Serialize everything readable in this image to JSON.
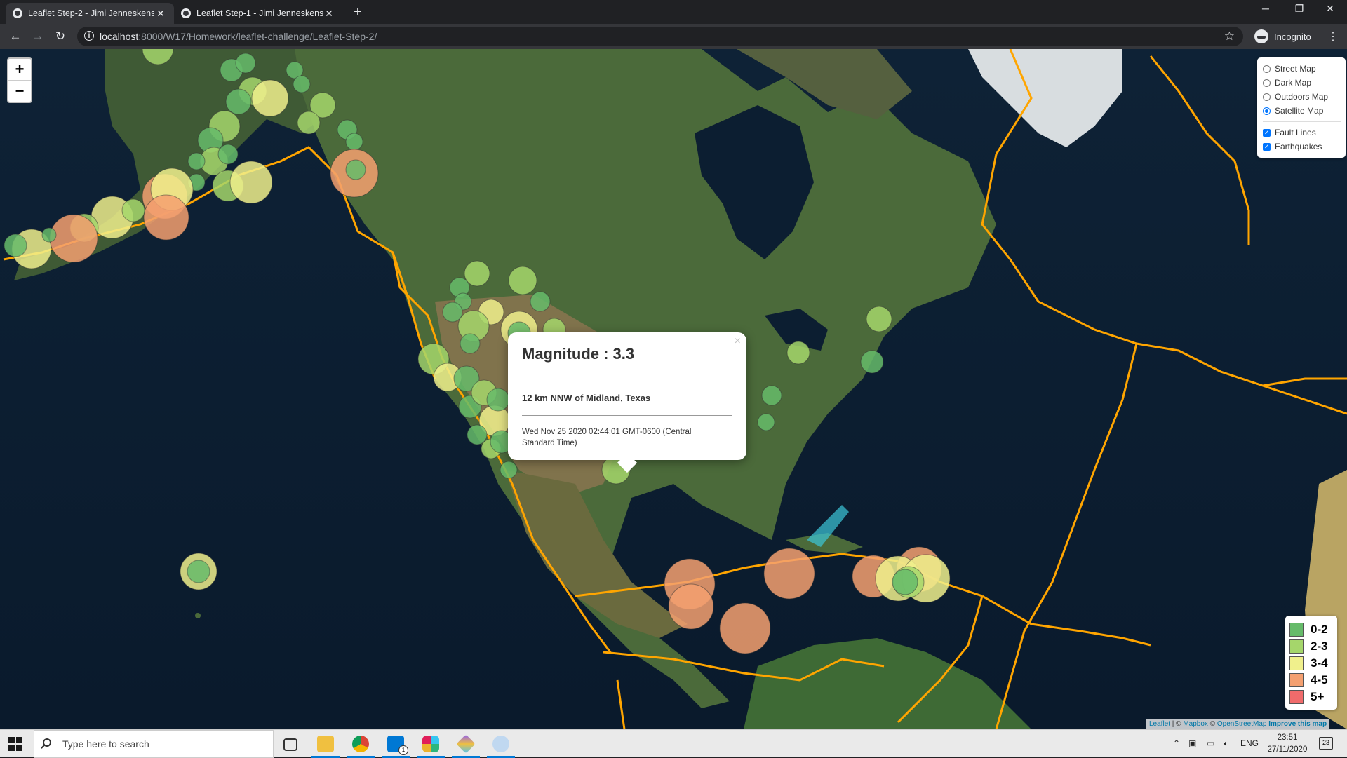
{
  "browser": {
    "tabs": [
      {
        "title": "Leaflet Step-2 - Jimi Jenneskens",
        "active": true
      },
      {
        "title": "Leaflet Step-1 - Jimi Jenneskens",
        "active": false
      }
    ],
    "url_host": "localhost",
    "url_path": ":8000/W17/Homework/leaflet-challenge/Leaflet-Step-2/",
    "profile_label": "Incognito"
  },
  "map": {
    "zoom_in": "+",
    "zoom_out": "−",
    "layers": {
      "base": [
        {
          "label": "Street Map",
          "selected": false
        },
        {
          "label": "Dark Map",
          "selected": false
        },
        {
          "label": "Outdoors Map",
          "selected": false
        },
        {
          "label": "Satellite Map",
          "selected": true
        }
      ],
      "overlays": [
        {
          "label": "Fault Lines",
          "checked": true
        },
        {
          "label": "Earthquakes",
          "checked": true
        }
      ]
    },
    "popup": {
      "magnitude": "Magnitude : 3.3",
      "place": "12 km NNW of Midland, Texas",
      "time": "Wed Nov 25 2020 02:44:01 GMT-0600 (Central Standard Time)",
      "close": "×"
    },
    "legend": [
      {
        "label": "0-2",
        "color": "#66bb6a"
      },
      {
        "label": "2-3",
        "color": "#a5d66b"
      },
      {
        "label": "3-4",
        "color": "#f0f08c"
      },
      {
        "label": "4-5",
        "color": "#f4a070"
      },
      {
        "label": "5+",
        "color": "#f06b6b"
      }
    ],
    "attribution": {
      "leaflet": "Leaflet",
      "mapbox": "Mapbox",
      "osm": "OpenStreetMap",
      "improve": "Improve this map",
      "sep1": " | © ",
      "sep2": " © "
    }
  },
  "taskbar": {
    "search_placeholder": "Type here to search",
    "language": "ENG",
    "time": "23:51",
    "date": "27/11/2020",
    "notification_count": "23",
    "mail_badge": "1"
  }
}
